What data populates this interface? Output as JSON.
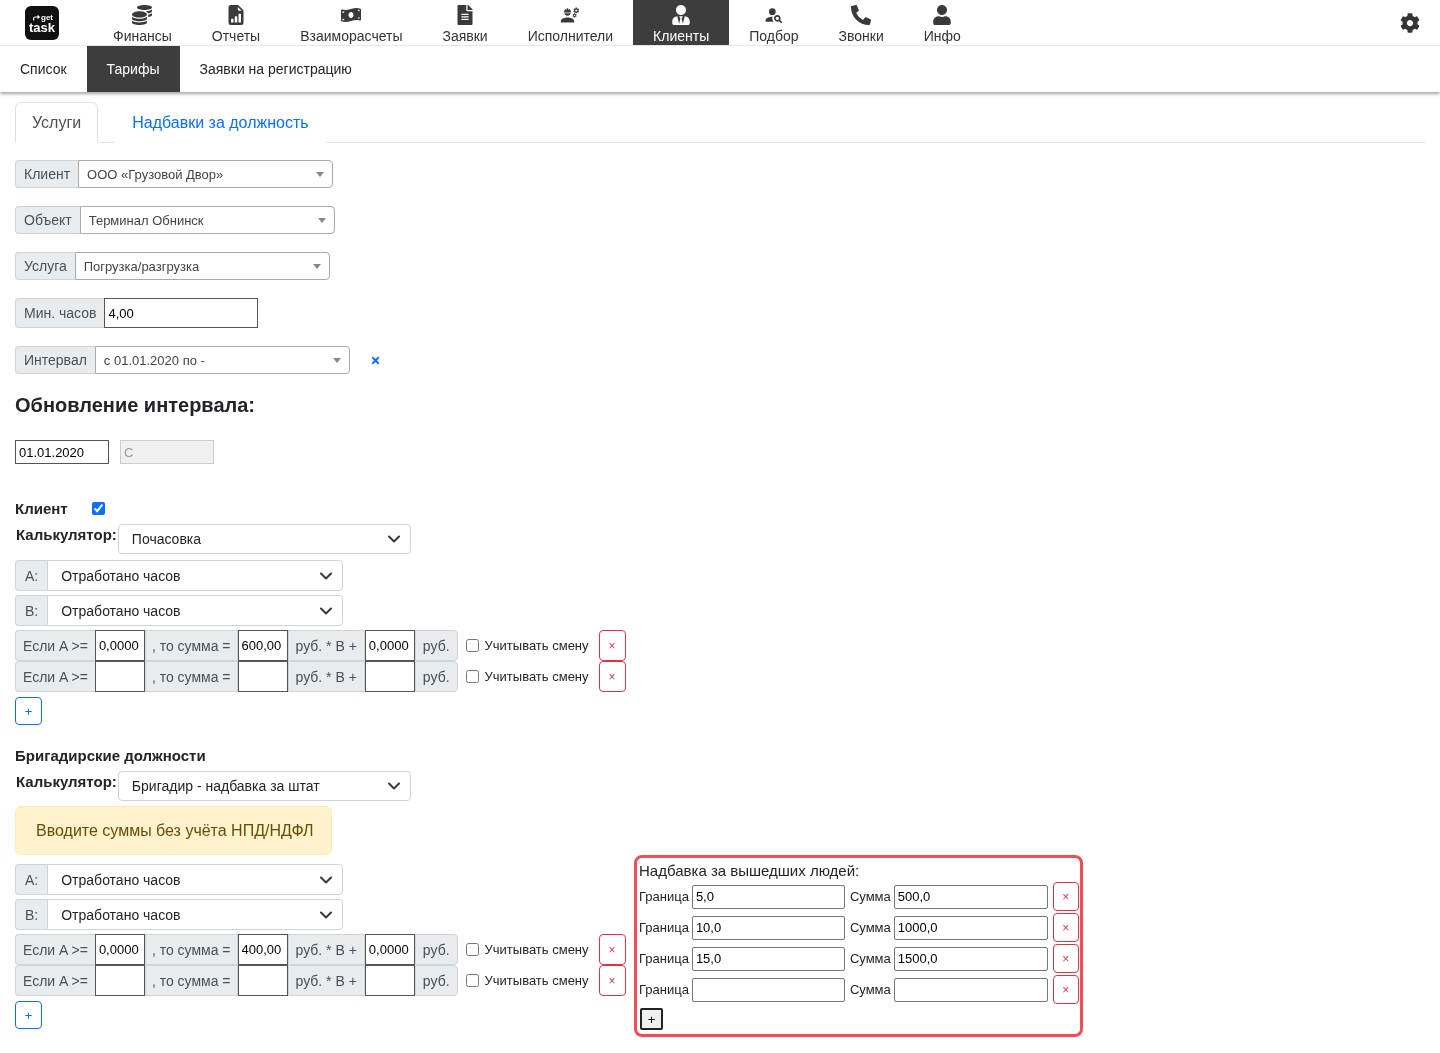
{
  "logo": {
    "top": "get",
    "bottom": "task"
  },
  "main_nav": [
    {
      "label": "Финансы",
      "selected": false
    },
    {
      "label": "Отчеты",
      "selected": false
    },
    {
      "label": "Взаиморасчеты",
      "selected": false
    },
    {
      "label": "Заявки",
      "selected": false
    },
    {
      "label": "Исполнители",
      "selected": false
    },
    {
      "label": "Клиенты",
      "selected": true
    },
    {
      "label": "Подбор",
      "selected": false
    },
    {
      "label": "Звонки",
      "selected": false
    },
    {
      "label": "Инфо",
      "selected": false
    }
  ],
  "sub_nav": [
    {
      "label": "Список",
      "selected": false
    },
    {
      "label": "Тарифы",
      "selected": true
    },
    {
      "label": "Заявки на регистрацию",
      "selected": false
    }
  ],
  "tabs": [
    {
      "label": "Услуги",
      "selected": true
    },
    {
      "label": "Надбавки за должность",
      "selected": false
    }
  ],
  "filters": [
    {
      "kind": "select",
      "label": "Клиент",
      "value": "ООО «Грузовой Двор»"
    },
    {
      "kind": "select",
      "label": "Объект",
      "value": "Терминал Обнинск"
    },
    {
      "kind": "select",
      "label": "Услуга",
      "value": "Погрузка/разгрузка"
    },
    {
      "kind": "input",
      "label": "Мин. часов",
      "value": "4,00"
    },
    {
      "kind": "select",
      "label": "Интервал",
      "value": "с 01.01.2020 по -",
      "clearable": true
    }
  ],
  "interval_update": {
    "title": "Обновление интервала:",
    "date_from": {
      "value": "01.01.2020",
      "disabled": false
    },
    "date_to": {
      "placeholder": "С",
      "disabled": true
    }
  },
  "sections": [
    {
      "title": "Клиент",
      "checkbox": {
        "checked": true
      },
      "calculator_label": "Калькулятор:",
      "calculator": "Почасовка",
      "variables": [
        {
          "label": "A:",
          "value": "Отработано часов"
        },
        {
          "label": "B:",
          "value": "Отработано часов"
        }
      ],
      "rules": [
        {
          "if_label": "Если A >=",
          "threshold": "0,0000",
          "then_label": ", то сумма =",
          "amount": "600,00",
          "mult_label": "руб. * B +",
          "addition": "0,0000",
          "currency": "руб.",
          "count_shift": false,
          "shift_label": "Учитывать смену",
          "remove": "×"
        },
        {
          "if_label": "Если A >=",
          "then_label": ", то сумма =",
          "mult_label": "руб. * B +",
          "currency": "руб.",
          "count_shift": false,
          "shift_label": "Учитывать смену",
          "remove": "×"
        }
      ],
      "add_button": "+"
    },
    {
      "title": "Бригадирские должности",
      "calculator_label": "Калькулятор:",
      "calculator": "Бригадир - надбавка за штат",
      "notice": "Вводите суммы без учёта НПД/НДФЛ",
      "variables": [
        {
          "label": "A:",
          "value": "Отработано часов"
        },
        {
          "label": "B:",
          "value": "Отработано часов"
        }
      ],
      "rules": [
        {
          "if_label": "Если A >=",
          "threshold": "0,0000",
          "then_label": ", то сумма =",
          "amount": "400,00",
          "mult_label": "руб. * B +",
          "addition": "0,0000",
          "currency": "руб.",
          "count_shift": false,
          "shift_label": "Учитывать смену",
          "remove": "×"
        },
        {
          "if_label": "Если A >=",
          "then_label": ", то сумма =",
          "mult_label": "руб. * B +",
          "currency": "руб.",
          "count_shift": false,
          "shift_label": "Учитывать смену",
          "remove": "×"
        }
      ],
      "add_button": "+",
      "bonus_panel": {
        "title": "Надбавка за вышедших людей:",
        "rows": [
          {
            "limit_label": "Граница",
            "limit": "5,0",
            "sum_label": "Сумма",
            "sum": "500,0",
            "remove": "×"
          },
          {
            "limit_label": "Граница",
            "limit": "10,0",
            "sum_label": "Сумма",
            "sum": "1000,0",
            "remove": "×"
          },
          {
            "limit_label": "Граница",
            "limit": "15,0",
            "sum_label": "Сумма",
            "sum": "1500,0",
            "remove": "×"
          },
          {
            "limit_label": "Граница",
            "sum_label": "Сумма",
            "remove": "×"
          }
        ],
        "add_button": "+"
      }
    }
  ]
}
